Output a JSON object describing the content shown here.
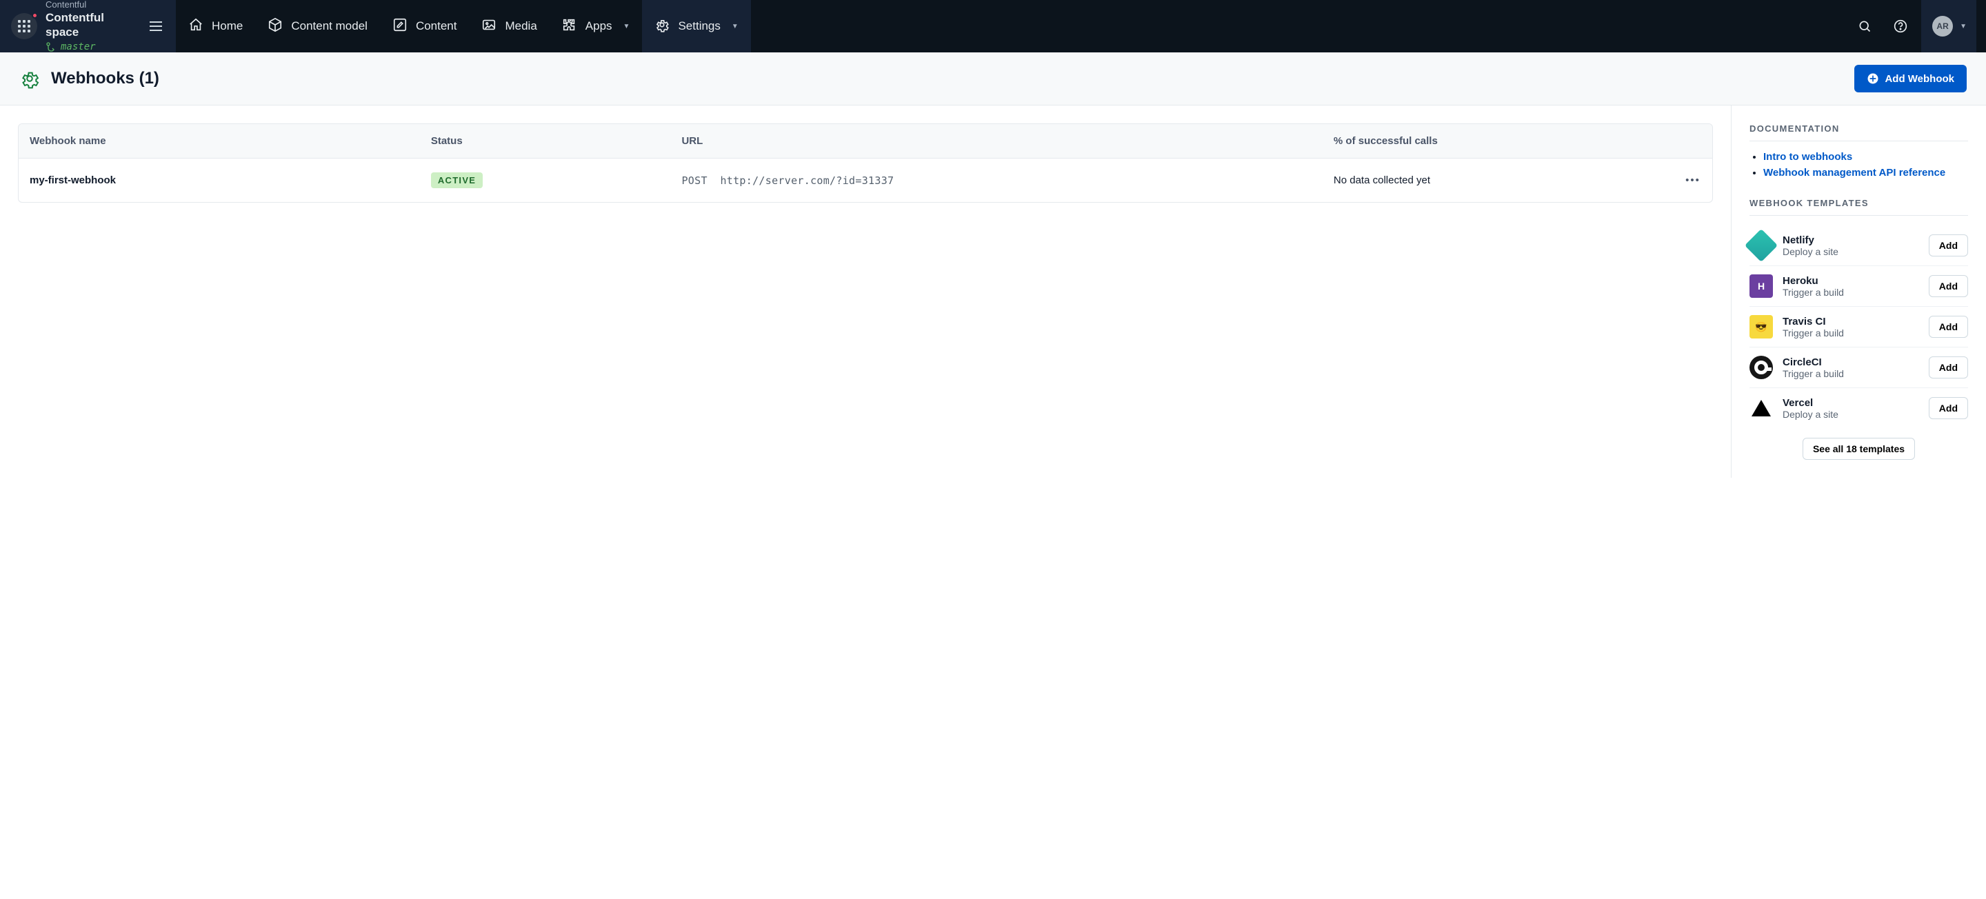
{
  "header": {
    "org": "Contentful",
    "space": "Contentful space",
    "branch": "master",
    "avatar": "AR",
    "nav": [
      {
        "label": "Home",
        "icon": "home"
      },
      {
        "label": "Content model",
        "icon": "box"
      },
      {
        "label": "Content",
        "icon": "pen"
      },
      {
        "label": "Media",
        "icon": "image"
      },
      {
        "label": "Apps",
        "icon": "puzzle",
        "caret": true
      },
      {
        "label": "Settings",
        "icon": "gear",
        "caret": true,
        "active": true
      }
    ]
  },
  "page": {
    "title": "Webhooks (1)",
    "add_button": "Add Webhook"
  },
  "table": {
    "columns": [
      "Webhook name",
      "Status",
      "URL",
      "% of successful calls"
    ],
    "rows": [
      {
        "name": "my-first-webhook",
        "status": "ACTIVE",
        "method": "POST",
        "url": "http://server.com/?id=31337",
        "success": "No data collected yet"
      }
    ]
  },
  "sidebar": {
    "docs_title": "Documentation",
    "docs": [
      {
        "label": "Intro to webhooks"
      },
      {
        "label": "Webhook management API reference"
      }
    ],
    "templates_title": "Webhook templates",
    "templates": [
      {
        "name": "Netlify",
        "desc": "Deploy a site",
        "icon": "netlify"
      },
      {
        "name": "Heroku",
        "desc": "Trigger a build",
        "icon": "heroku"
      },
      {
        "name": "Travis CI",
        "desc": "Trigger a build",
        "icon": "travis"
      },
      {
        "name": "CircleCI",
        "desc": "Trigger a build",
        "icon": "circle"
      },
      {
        "name": "Vercel",
        "desc": "Deploy a site",
        "icon": "vercel"
      }
    ],
    "add_label": "Add",
    "see_all": "See all 18 templates"
  }
}
